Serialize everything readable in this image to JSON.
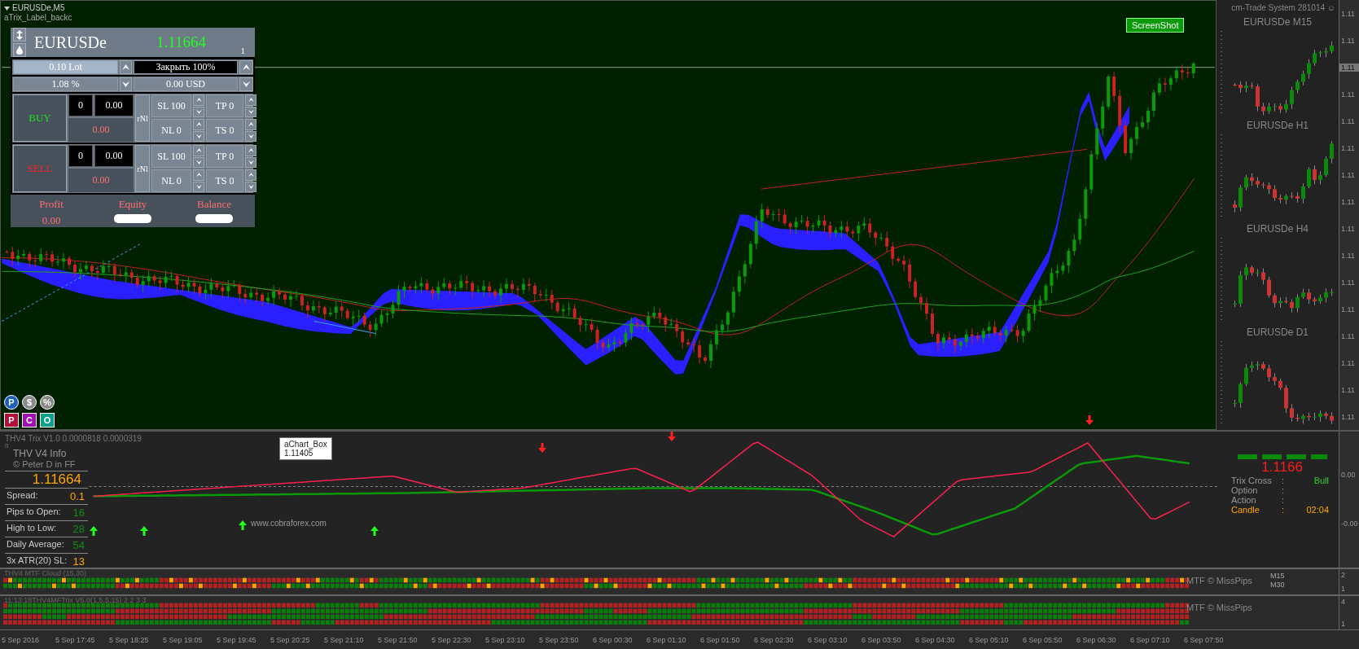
{
  "chart_header": {
    "symbol_timeframe": "EURUSDe,M5",
    "indicator_label": "aTrix_Label_backc"
  },
  "trade_panel": {
    "symbol": "EURUSDe",
    "price": "1.11664",
    "counter": "1",
    "lot": "0.10 Lot",
    "close_label": "Закрыть 100%",
    "risk": "1.08 %",
    "amount": "0.00 USD",
    "sides": [
      {
        "kind": "buy",
        "label": "BUY",
        "count": "0",
        "volume": "0.00",
        "profit": "0.00",
        "mode": "rNl",
        "sl": "SL 100",
        "nl": "NL 0",
        "tp": "TP 0",
        "ts": "TS 0"
      },
      {
        "kind": "sell",
        "label": "SELL",
        "count": "0",
        "volume": "0.00",
        "profit": "0.00",
        "mode": "rNl",
        "sl": "SL 100",
        "nl": "NL 0",
        "tp": "TP 0",
        "ts": "TS 0"
      }
    ],
    "summary": [
      {
        "label": "Profit",
        "value": "0.00",
        "hidden": false
      },
      {
        "label": "Equity",
        "hidden": true
      },
      {
        "label": "Balance",
        "hidden": true
      }
    ]
  },
  "screenshot_button": "ScreenShot",
  "quick_buttons": [
    {
      "label": "P",
      "kind": "round",
      "color": "#1a5fc0"
    },
    {
      "label": "$",
      "kind": "round",
      "color": "#8a8a8a"
    },
    {
      "label": "%",
      "kind": "round",
      "color": "#8a8a8a"
    },
    {
      "label": "P",
      "kind": "square",
      "color": "#b0103a"
    },
    {
      "label": "C",
      "kind": "square",
      "color": "#a010b0"
    },
    {
      "label": "O",
      "kind": "square",
      "color": "#10a08a"
    }
  ],
  "mini_charts": {
    "caption": "cm-Trade System 281014 ☺",
    "titles": [
      "EURUSDe M15",
      "EURUSDe H1",
      "EURUSDe H4",
      "EURUSDe D1"
    ]
  },
  "price_axis": [
    {
      "text": "1.11",
      "current": false
    },
    {
      "text": "1.11",
      "current": false
    },
    {
      "text": "1.11",
      "current": true
    },
    {
      "text": "1.11",
      "current": false
    },
    {
      "text": "1.11",
      "current": false
    },
    {
      "text": "1.11",
      "current": false
    },
    {
      "text": "1.11",
      "current": false
    },
    {
      "text": "1.11",
      "current": false
    },
    {
      "text": "1.11",
      "current": false
    },
    {
      "text": "1.11",
      "current": false
    },
    {
      "text": "1.11",
      "current": false
    },
    {
      "text": "1.11",
      "current": false
    },
    {
      "text": "1.11",
      "current": false
    },
    {
      "text": "1.11",
      "current": false
    },
    {
      "text": "1.11",
      "current": false
    },
    {
      "text": "1.11",
      "current": false
    }
  ],
  "indicator": {
    "title": "THV4 Trix V1.0 0.0000818 0.0000319",
    "level_label": "0",
    "info": {
      "title": "THV  V4  Info",
      "credit": "© Peter D in FF",
      "price": "1.11664",
      "rows": [
        {
          "label": "Spread:",
          "value": "0.1",
          "color": "#ffa500"
        },
        {
          "label": "Pips to Open:",
          "value": "16",
          "color": "#138a13"
        },
        {
          "label": "High to Low:",
          "value": "28",
          "color": "#138a13"
        },
        {
          "label": "Daily Average:",
          "value": "54",
          "color": "#138a13"
        },
        {
          "label": "3x ATR(20) SL:",
          "value": "13",
          "color": "#ffa500"
        }
      ]
    },
    "tooltip": {
      "title": "aChart_Box",
      "value": "1.11405"
    },
    "site_label": "www.cobraforex.com",
    "signal": {
      "price": "1.1166",
      "rows": [
        {
          "kind": "status",
          "label": "Trix Cross",
          "separator": ":",
          "value": "Bull"
        },
        {
          "kind": "status",
          "label": "Option",
          "separator": ":"
        },
        {
          "kind": "status",
          "label": "Action",
          "separator": ":"
        },
        {
          "kind": "timer",
          "label": "Candle",
          "separator": ":",
          "value": "02:04"
        }
      ]
    },
    "axis": [
      "0.00",
      "-0.00"
    ]
  },
  "mtf_panes": [
    {
      "kind": "cloud",
      "title": "THV4 MTF Cloud (15,30)",
      "credit": "MTF © MissPips",
      "timeframes": [
        "M15",
        "M30"
      ],
      "axis": [
        "2",
        "1"
      ]
    },
    {
      "kind": "trix",
      "title": "11:13:18THV4MFTrix V6.0(1,5,5,15) 2 2 3 3",
      "credit": "MTF © MissPips",
      "axis": [
        "4",
        "1"
      ]
    }
  ],
  "time_axis": [
    "5 Sep 2016",
    "5 Sep 17:45",
    "5 Sep 18:25",
    "5 Sep 19:05",
    "5 Sep 19:45",
    "5 Sep 20:25",
    "5 Sep 21:10",
    "5 Sep 21:50",
    "5 Sep 22:30",
    "5 Sep 23:10",
    "5 Sep 23:50",
    "6 Sep 00:30",
    "6 Sep 01:10",
    "6 Sep 01:50",
    "6 Sep 02:30",
    "6 Sep 03:10",
    "6 Sep 03:50",
    "6 Sep 04:30",
    "6 Sep 05:10",
    "6 Sep 05:50",
    "6 Sep 06:30",
    "6 Sep 07:10",
    "6 Sep 07:50"
  ]
}
